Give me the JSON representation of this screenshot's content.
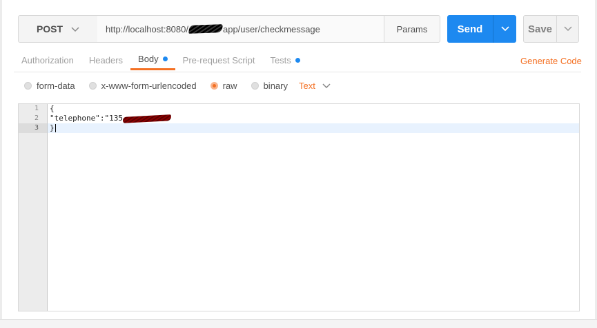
{
  "request": {
    "method": "POST",
    "url_prefix": "http://localhost:8080/",
    "url_suffix": "app/user/checkmessage",
    "params_label": "Params",
    "send_label": "Send",
    "save_label": "Save"
  },
  "tabs": [
    {
      "label": "Authorization",
      "active": false,
      "dot": false
    },
    {
      "label": "Headers",
      "active": false,
      "dot": false
    },
    {
      "label": "Body",
      "active": true,
      "dot": true
    },
    {
      "label": "Pre-request Script",
      "active": false,
      "dot": false
    },
    {
      "label": "Tests",
      "active": false,
      "dot": true
    }
  ],
  "generate_code_label": "Generate Code",
  "body_modes": [
    {
      "label": "form-data",
      "checked": false
    },
    {
      "label": "x-www-form-urlencoded",
      "checked": false
    },
    {
      "label": "raw",
      "checked": true
    },
    {
      "label": "binary",
      "checked": false
    }
  ],
  "raw_type": "Text",
  "editor": {
    "line_numbers": [
      "1",
      "2",
      "3"
    ],
    "lines": [
      "{",
      "\"telephone\":\"135",
      "}"
    ]
  },
  "colors": {
    "accent": "#f47023",
    "send_blue": "#1d89f0"
  }
}
